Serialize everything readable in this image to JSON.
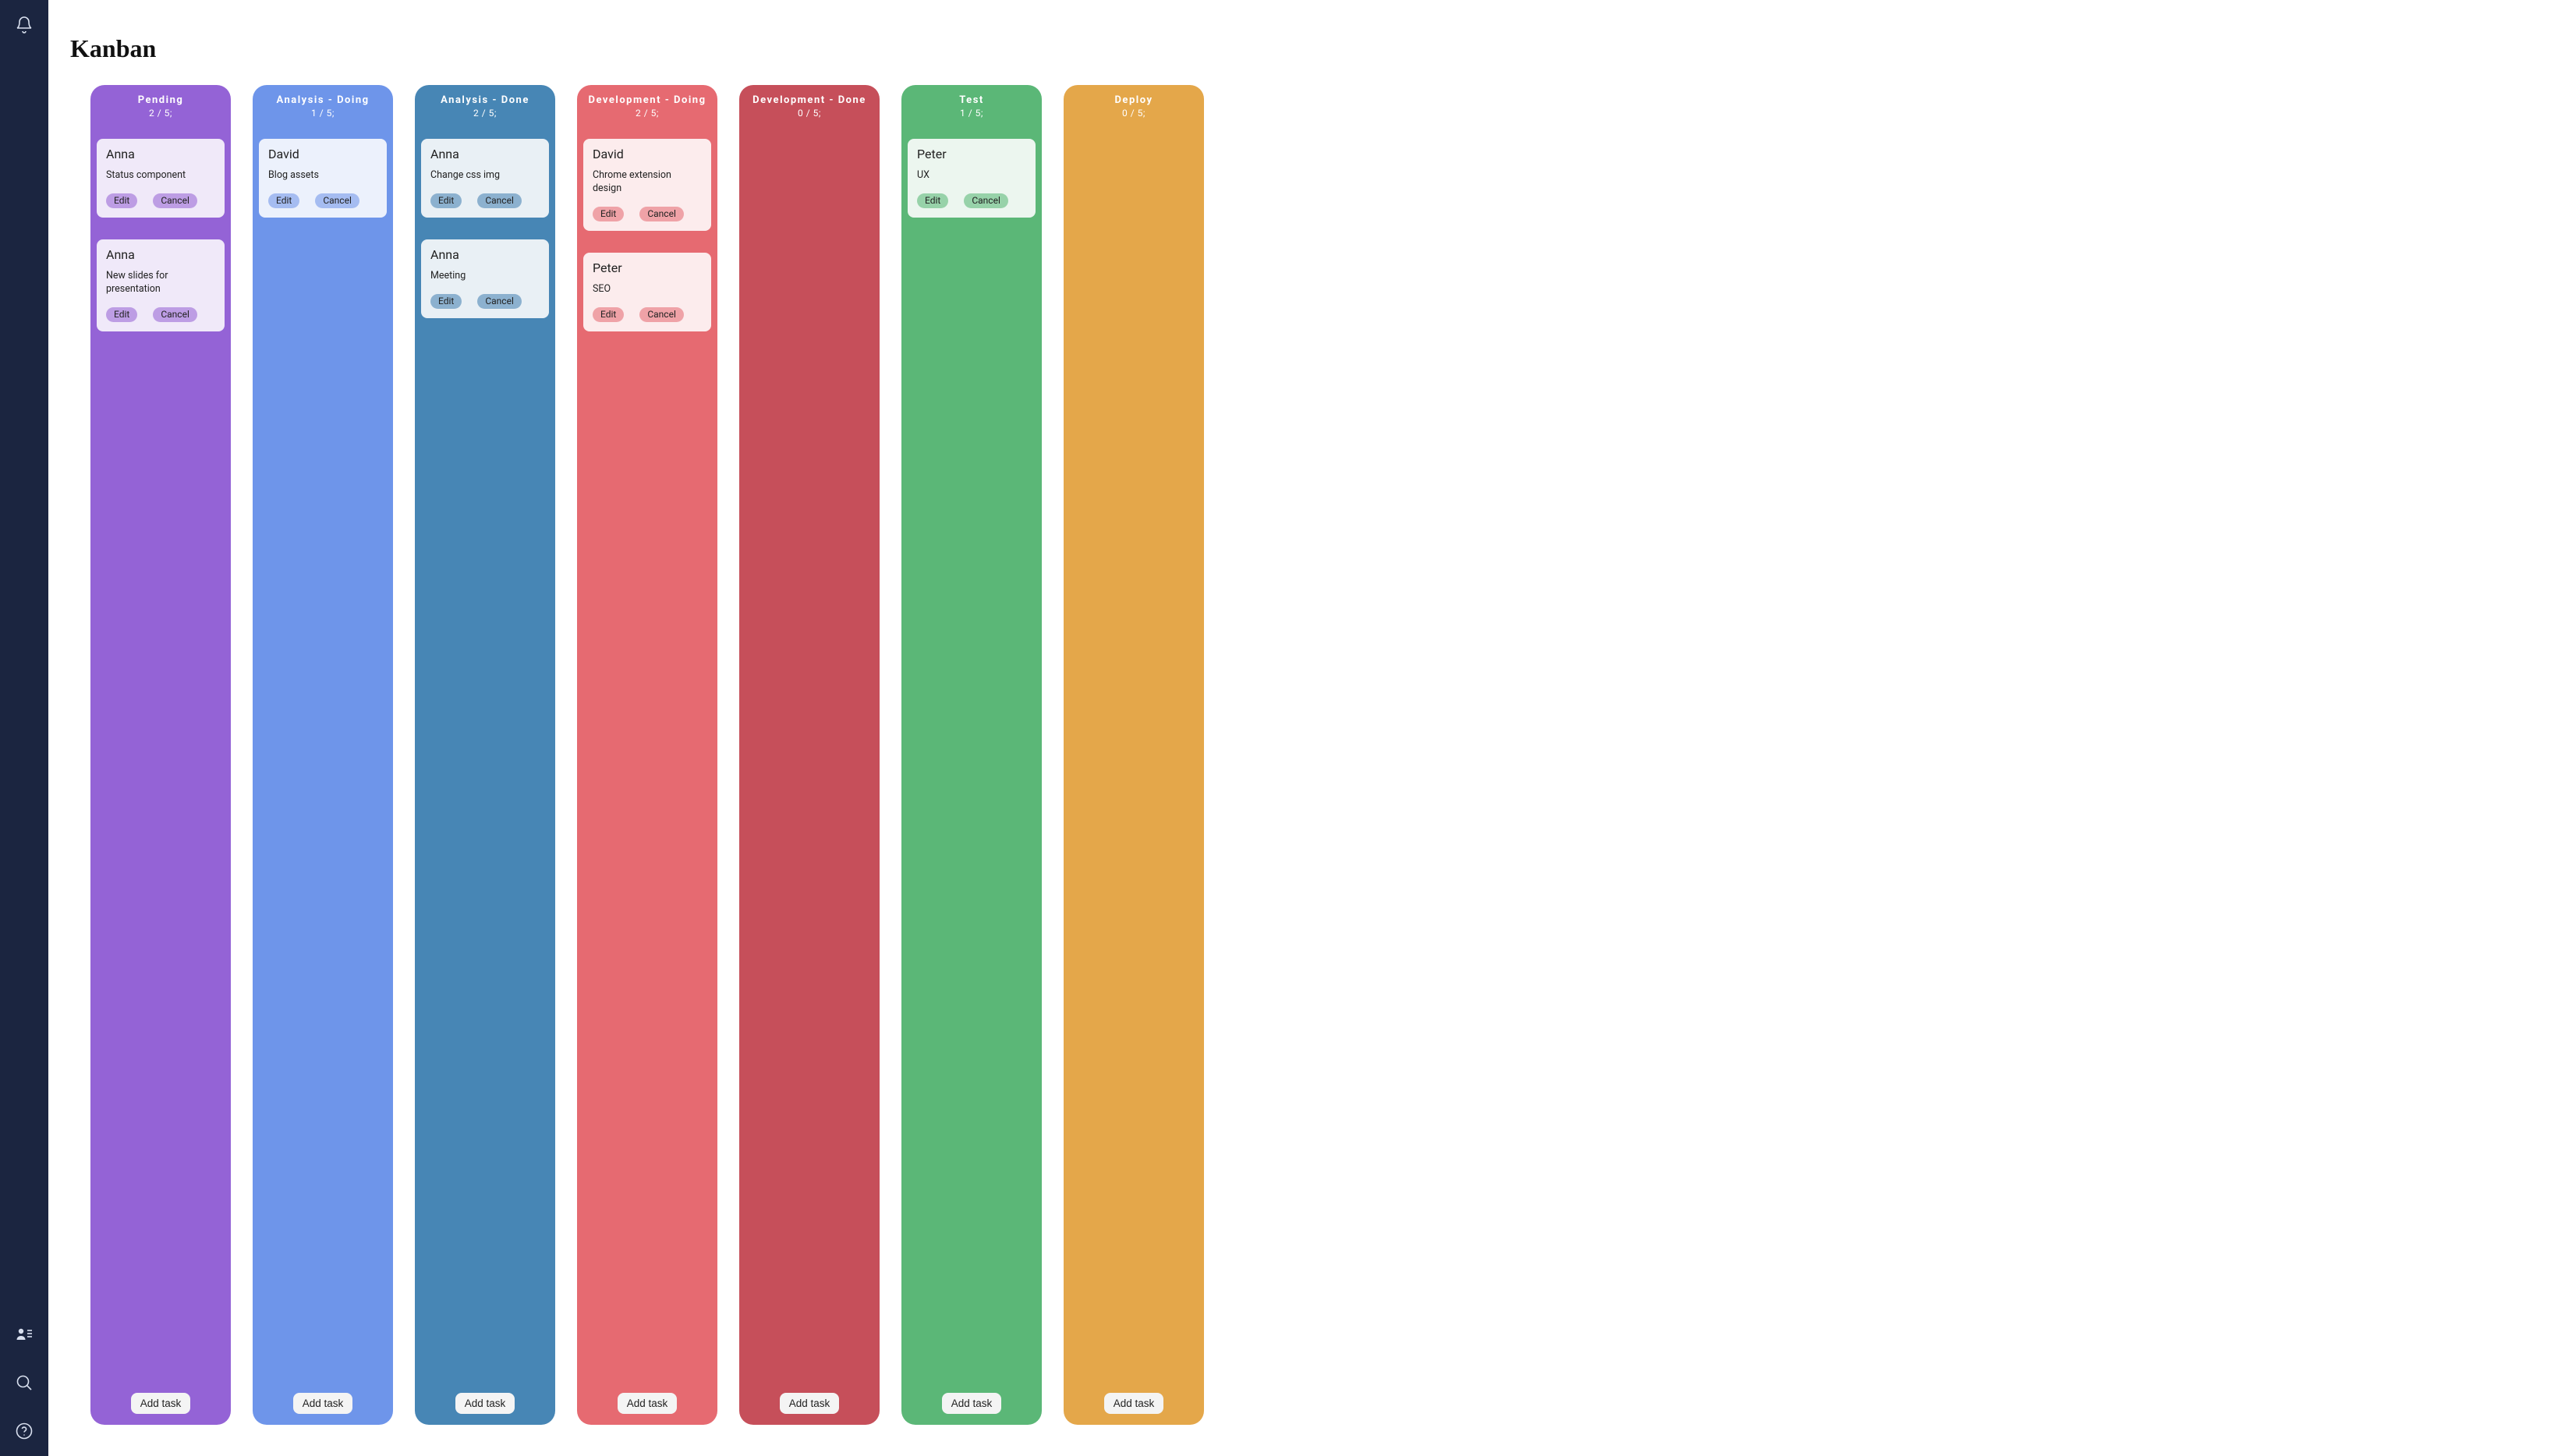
{
  "page_title": "Kanban",
  "labels": {
    "edit": "Edit",
    "cancel": "Cancel",
    "add_task": "Add task"
  },
  "sidebar": {
    "top_icons": [
      "bell-icon"
    ],
    "bottom_icons": [
      "person-list-icon",
      "search-icon",
      "help-icon"
    ]
  },
  "columns": [
    {
      "id": "pending",
      "title": "Pending",
      "count": "2 / 5;",
      "class": "col-pending",
      "cards": [
        {
          "user": "Anna",
          "desc": "Status component"
        },
        {
          "user": "Anna",
          "desc": "New slides for presentation"
        }
      ]
    },
    {
      "id": "analysis-doing",
      "title": "Analysis - Doing",
      "count": "1 / 5;",
      "class": "col-analysis-doing",
      "cards": [
        {
          "user": "David",
          "desc": "Blog assets"
        }
      ]
    },
    {
      "id": "analysis-done",
      "title": "Analysis - Done",
      "count": "2 / 5;",
      "class": "col-analysis-done",
      "cards": [
        {
          "user": "Anna",
          "desc": "Change css img"
        },
        {
          "user": "Anna",
          "desc": "Meeting"
        }
      ]
    },
    {
      "id": "dev-doing",
      "title": "Development - Doing",
      "count": "2 / 5;",
      "class": "col-dev-doing",
      "cards": [
        {
          "user": "David",
          "desc": "Chrome extension design"
        },
        {
          "user": "Peter",
          "desc": "SEO"
        }
      ]
    },
    {
      "id": "dev-done",
      "title": "Development - Done",
      "count": "0 / 5;",
      "class": "col-dev-done",
      "cards": []
    },
    {
      "id": "test",
      "title": "Test",
      "count": "1 / 5;",
      "class": "col-test",
      "cards": [
        {
          "user": "Peter",
          "desc": "UX"
        }
      ]
    },
    {
      "id": "deploy",
      "title": "Deploy",
      "count": "0 / 5;",
      "class": "col-deploy",
      "cards": []
    }
  ]
}
